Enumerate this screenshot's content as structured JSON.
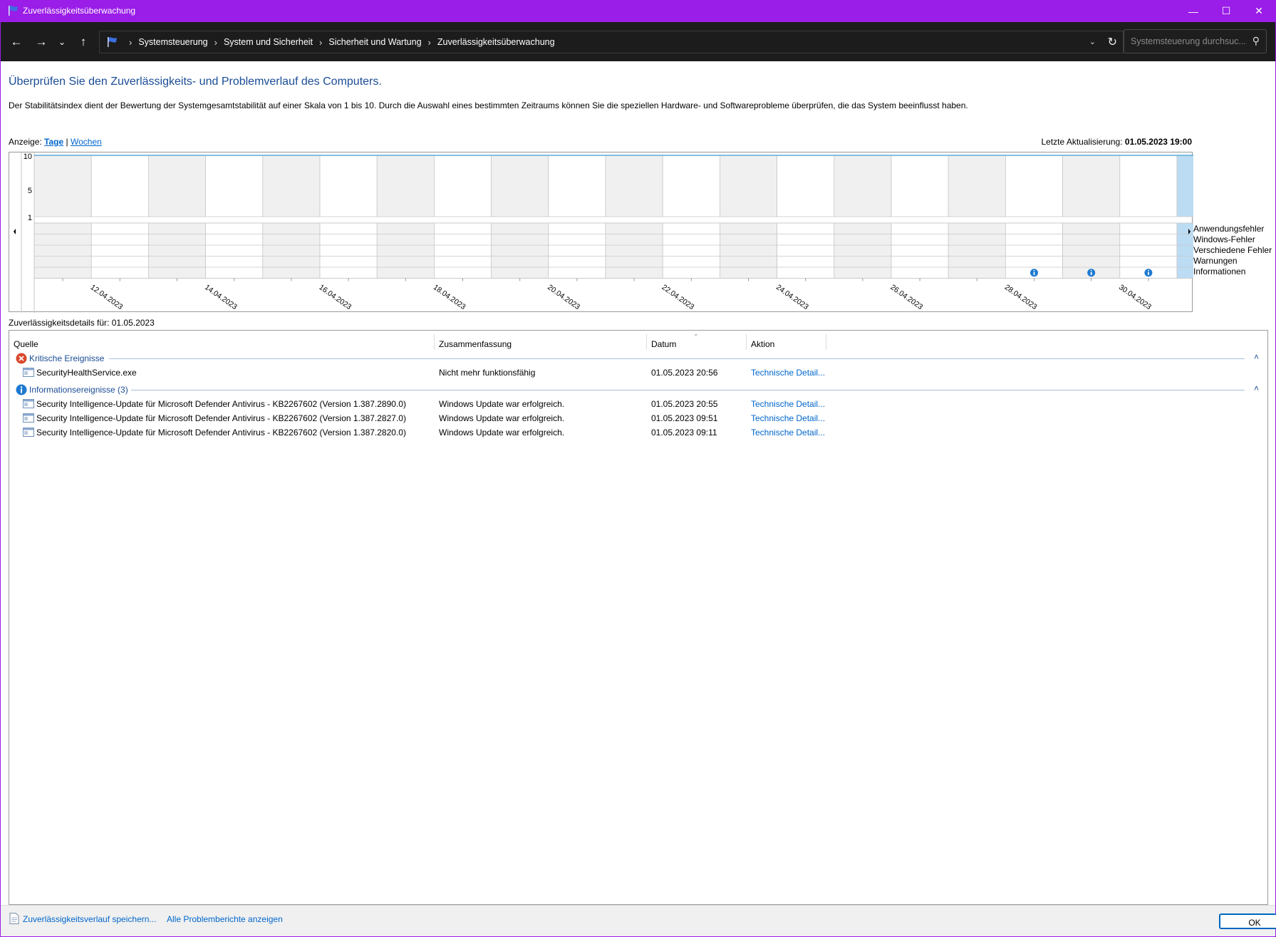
{
  "window": {
    "title": "Zuverlässigkeitsüberwachung",
    "accent_color": "#9a1de8"
  },
  "navbar": {
    "breadcrumbs": [
      "Systemsteuerung",
      "System und Sicherheit",
      "Sicherheit und Wartung",
      "Zuverlässigkeitsüberwachung"
    ],
    "search_placeholder": "Systemsteuerung durchsuc..."
  },
  "page": {
    "heading": "Überprüfen Sie den Zuverlässigkeits- und Problemverlauf des Computers.",
    "description": "Der Stabilitätsindex dient der Bewertung der Systemgesamtstabilität auf einer Skala von 1 bis 10. Durch die Auswahl eines bestimmten Zeitraums können Sie die speziellen Hardware- und Softwareprobleme überprüfen, die das System beeinflusst haben.",
    "view_label": "Anzeige:",
    "view_days": "Tage",
    "view_separator": "|",
    "view_weeks": "Wochen",
    "last_update_label": "Letzte Aktualisierung:",
    "last_update_value": "01.05.2023 19:00"
  },
  "chart_data": {
    "type": "timeline",
    "y_ticks": [
      "10",
      "5",
      "1"
    ],
    "ylim": [
      1,
      10
    ],
    "columns": [
      "11.04.2023",
      "12.04.2023",
      "13.04.2023",
      "14.04.2023",
      "15.04.2023",
      "16.04.2023",
      "17.04.2023",
      "18.04.2023",
      "19.04.2023",
      "20.04.2023",
      "21.04.2023",
      "22.04.2023",
      "23.04.2023",
      "24.04.2023",
      "25.04.2023",
      "26.04.2023",
      "27.04.2023",
      "28.04.2023",
      "29.04.2023",
      "30.04.2023",
      "01.05.2023"
    ],
    "x_tick_labels": [
      "12.04.2023",
      "14.04.2023",
      "16.04.2023",
      "18.04.2023",
      "20.04.2023",
      "22.04.2023",
      "24.04.2023",
      "26.04.2023",
      "28.04.2023",
      "30.04.2023"
    ],
    "stability_index": [
      10,
      10,
      10,
      10,
      10,
      10,
      10,
      10,
      10,
      10,
      10,
      10,
      10,
      10,
      10,
      10,
      10,
      10,
      10,
      10,
      10
    ],
    "selected_column": "01.05.2023",
    "rows": [
      "Anwendungsfehler",
      "Windows-Fehler",
      "Verschiedene Fehler",
      "Warnungen",
      "Informationen"
    ],
    "events": [
      {
        "date": "01.05.2023",
        "row": "Anwendungsfehler",
        "icon": "critical-error-icon"
      },
      {
        "date": "28.04.2023",
        "row": "Informationen",
        "icon": "info-icon"
      },
      {
        "date": "29.04.2023",
        "row": "Informationen",
        "icon": "info-icon"
      },
      {
        "date": "30.04.2023",
        "row": "Informationen",
        "icon": "info-icon"
      },
      {
        "date": "01.05.2023",
        "row": "Informationen",
        "icon": "info-icon"
      }
    ],
    "colors": {
      "shaded": "#f0f0f0",
      "selected": "#bcdcf4",
      "line": "#5fa9d8",
      "error": "#d9472b",
      "info": "#1e7ad0"
    }
  },
  "details": {
    "title": "Zuverlässigkeitsdetails für: 01.05.2023",
    "columns": [
      "Quelle",
      "Zusammenfassung",
      "Datum",
      "Aktion"
    ],
    "groups": [
      {
        "title": "Kritische Ereignisse",
        "icon": "critical-error-icon",
        "rows": [
          {
            "source": "SecurityHealthService.exe",
            "summary": "Nicht mehr funktionsfähig",
            "date": "01.05.2023 20:56",
            "action": "Technische Detail..."
          }
        ]
      },
      {
        "title": "Informationsereignisse (3)",
        "icon": "info-icon",
        "rows": [
          {
            "source": "Security Intelligence-Update für Microsoft Defender Antivirus - KB2267602 (Version 1.387.2890.0)",
            "summary": "Windows Update war erfolgreich.",
            "date": "01.05.2023 20:55",
            "action": "Technische Detail..."
          },
          {
            "source": "Security Intelligence-Update für Microsoft Defender Antivirus - KB2267602 (Version 1.387.2827.0)",
            "summary": "Windows Update war erfolgreich.",
            "date": "01.05.2023 09:51",
            "action": "Technische Detail..."
          },
          {
            "source": "Security Intelligence-Update für Microsoft Defender Antivirus - KB2267602 (Version 1.387.2820.0)",
            "summary": "Windows Update war erfolgreich.",
            "date": "01.05.2023 09:11",
            "action": "Technische Detail..."
          }
        ]
      }
    ]
  },
  "footer": {
    "save_link": "Zuverlässigkeitsverlauf speichern...",
    "reports_link": "Alle Problemberichte anzeigen",
    "ok_label": "OK"
  }
}
